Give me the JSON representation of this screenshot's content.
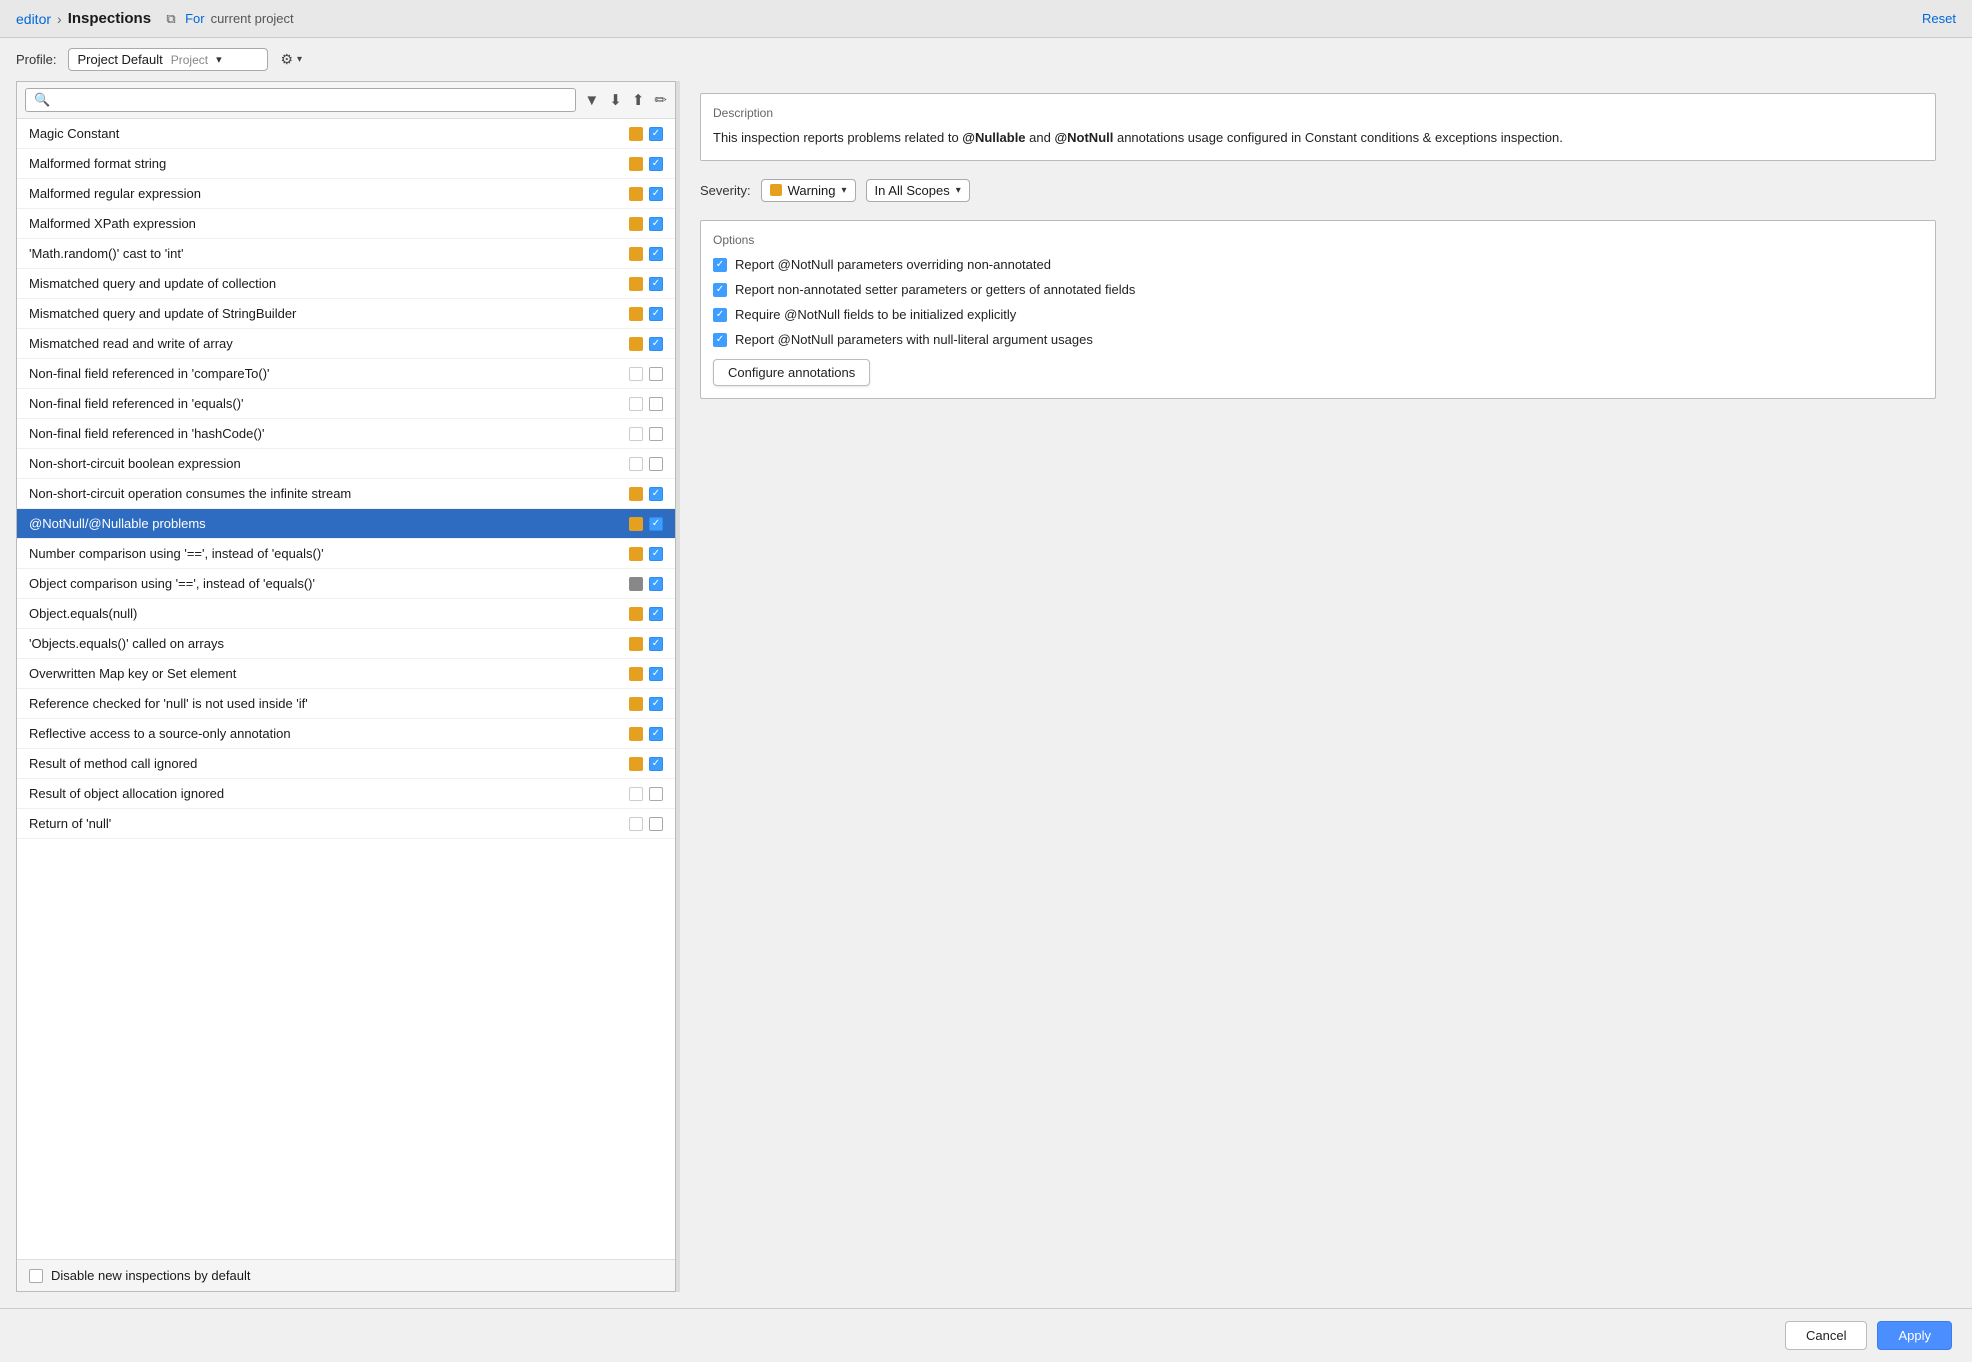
{
  "breadcrumb": {
    "editor_label": "editor",
    "separator": "›",
    "current": "Inspections",
    "for_label": "For",
    "project_label": "current project",
    "reset_label": "Reset"
  },
  "profile": {
    "label": "Profile:",
    "value": "Project Default",
    "tag": "Project"
  },
  "search": {
    "placeholder": "🔍"
  },
  "inspection_list": [
    {
      "label": "Magic Constant",
      "severity": "orange",
      "checked": true
    },
    {
      "label": "Malformed format string",
      "severity": "orange",
      "checked": true
    },
    {
      "label": "Malformed regular expression",
      "severity": "orange",
      "checked": true
    },
    {
      "label": "Malformed XPath expression",
      "severity": "orange",
      "checked": true
    },
    {
      "label": "'Math.random()' cast to 'int'",
      "severity": "orange",
      "checked": true
    },
    {
      "label": "Mismatched query and update of collection",
      "severity": "orange",
      "checked": true
    },
    {
      "label": "Mismatched query and update of StringBuilder",
      "severity": "orange",
      "checked": true
    },
    {
      "label": "Mismatched read and write of array",
      "severity": "orange",
      "checked": true
    },
    {
      "label": "Non-final field referenced in 'compareTo()'",
      "severity": "empty",
      "checked": false
    },
    {
      "label": "Non-final field referenced in 'equals()'",
      "severity": "empty",
      "checked": false
    },
    {
      "label": "Non-final field referenced in 'hashCode()'",
      "severity": "empty",
      "checked": false
    },
    {
      "label": "Non-short-circuit boolean expression",
      "severity": "empty",
      "checked": false
    },
    {
      "label": "Non-short-circuit operation consumes the infinite stream",
      "severity": "orange",
      "checked": true
    },
    {
      "label": "@NotNull/@Nullable problems",
      "severity": "orange",
      "checked": true,
      "selected": true
    },
    {
      "label": "Number comparison using '==', instead of 'equals()'",
      "severity": "orange",
      "checked": true
    },
    {
      "label": "Object comparison using '==', instead of 'equals()'",
      "severity": "gray",
      "checked": true
    },
    {
      "label": "Object.equals(null)",
      "severity": "orange",
      "checked": true
    },
    {
      "label": "'Objects.equals()' called on arrays",
      "severity": "orange",
      "checked": true
    },
    {
      "label": "Overwritten Map key or Set element",
      "severity": "orange",
      "checked": true
    },
    {
      "label": "Reference checked for 'null' is not used inside 'if'",
      "severity": "orange",
      "checked": true
    },
    {
      "label": "Reflective access to a source-only annotation",
      "severity": "orange",
      "checked": true
    },
    {
      "label": "Result of method call ignored",
      "severity": "orange",
      "checked": true
    },
    {
      "label": "Result of object allocation ignored",
      "severity": "empty",
      "checked": false
    },
    {
      "label": "Return of 'null'",
      "severity": "empty",
      "checked": false
    }
  ],
  "bottom_bar": {
    "label": "Disable new inspections by default"
  },
  "description": {
    "title": "Description",
    "text_parts": [
      "This inspection reports problems related to ",
      "@Nullable",
      " and ",
      "@NotNull",
      " annotations usage configured in Constant conditions & exceptions inspection."
    ]
  },
  "severity": {
    "label": "Severity:",
    "value": "Warning",
    "scope": "In All Scopes"
  },
  "options": {
    "title": "Options",
    "items": [
      "Report @NotNull parameters overriding non-annotated",
      "Report non-annotated setter parameters or getters of annotated fields",
      "Require @NotNull fields to be initialized explicitly",
      "Report @NotNull parameters with null-literal argument usages"
    ]
  },
  "configure_btn_label": "Configure annotations",
  "footer": {
    "cancel_label": "Cancel",
    "apply_label": "Apply"
  }
}
